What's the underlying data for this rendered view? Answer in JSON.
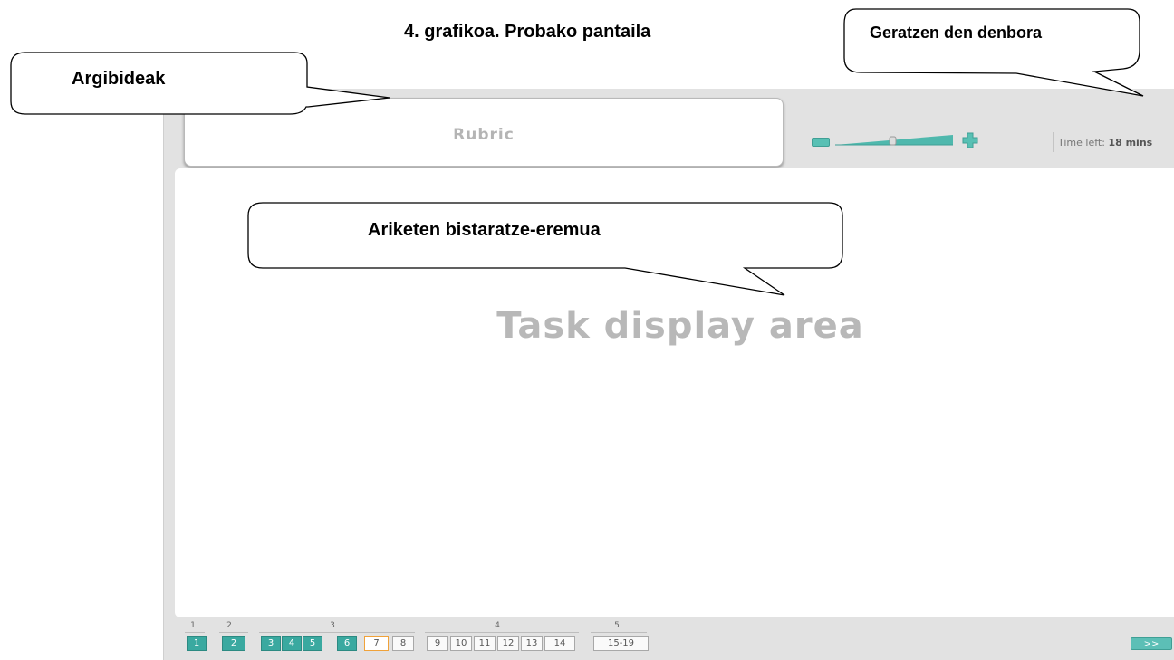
{
  "figure": {
    "caption": "4. grafikoa. Probako pantaila"
  },
  "callouts": {
    "time_left": "Geratzen den denbora",
    "instructions": "Argibideak",
    "task_area": "Ariketen bistaratze-eremua"
  },
  "header": {
    "rubric_label": "Rubric",
    "timer_prefix": "Time left:",
    "timer_value": "18 mins"
  },
  "main": {
    "task_display_label": "Task display area"
  },
  "navigation": {
    "groups": [
      {
        "label": "1"
      },
      {
        "label": "2"
      },
      {
        "label": "3"
      },
      {
        "label": "4"
      },
      {
        "label": "5"
      }
    ],
    "items": [
      {
        "label": "1",
        "state": "done"
      },
      {
        "label": "2",
        "state": "done"
      },
      {
        "label": "3",
        "state": "done"
      },
      {
        "label": "4",
        "state": "done"
      },
      {
        "label": "5",
        "state": "done"
      },
      {
        "label": "6",
        "state": "done"
      },
      {
        "label": "7",
        "state": "current"
      },
      {
        "label": "8",
        "state": "todo"
      },
      {
        "label": "9",
        "state": "todo"
      },
      {
        "label": "10",
        "state": "todo"
      },
      {
        "label": "11",
        "state": "todo"
      },
      {
        "label": "12",
        "state": "todo"
      },
      {
        "label": "13",
        "state": "todo"
      },
      {
        "label": "14",
        "state": "todo"
      },
      {
        "label": "15-19",
        "state": "todo"
      }
    ],
    "next_label": ">>"
  },
  "colors": {
    "accent": "#3aa9a0",
    "current_border": "#f0a23a",
    "frame_bg": "#e2e2e2"
  }
}
